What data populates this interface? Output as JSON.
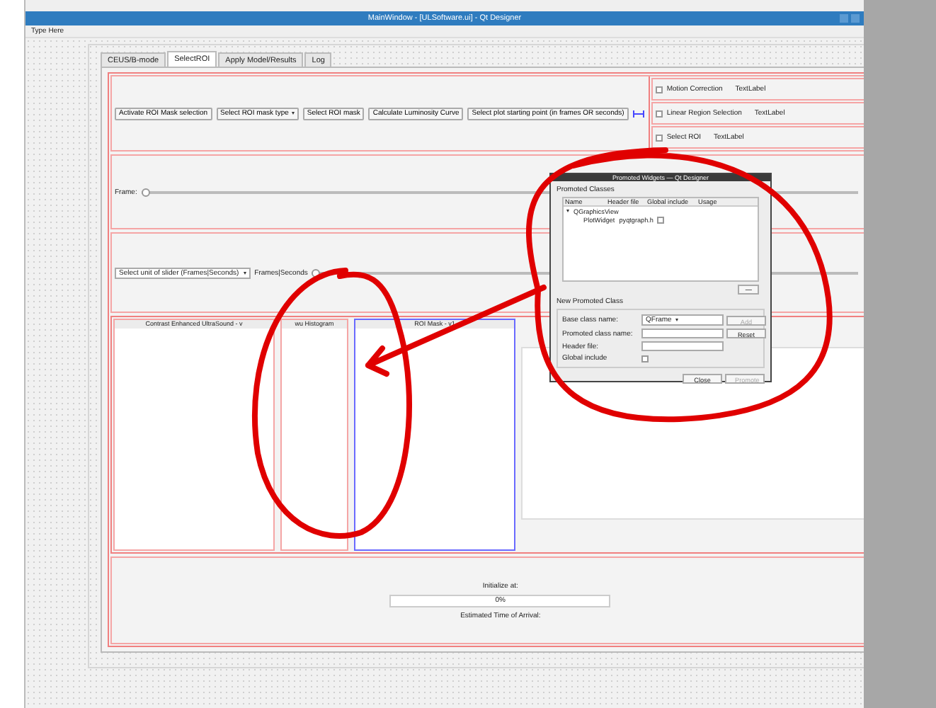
{
  "window": {
    "title": "MainWindow - [ULSoftware.ui] - Qt Designer"
  },
  "menu": [
    "Type Here"
  ],
  "tabs": [
    {
      "label": "CEUS/B-mode",
      "selected": false
    },
    {
      "label": "SelectROI",
      "selected": true
    },
    {
      "label": "Apply Model/Results",
      "selected": false
    },
    {
      "label": "Log",
      "selected": false
    }
  ],
  "toolbar": [
    {
      "kind": "button",
      "label": "Activate ROI Mask selection"
    },
    {
      "kind": "combo",
      "label": "Select ROI mask type"
    },
    {
      "kind": "button",
      "label": "Select ROI mask"
    },
    {
      "kind": "button",
      "label": "Calculate Luminosity Curve"
    },
    {
      "kind": "button",
      "label": "Select plot starting point (in frames OR seconds)"
    }
  ],
  "options": [
    {
      "label": "Motion Correction",
      "checked": false,
      "value": "TextLabel"
    },
    {
      "label": "Linear Region Selection",
      "checked": false,
      "value": "TextLabel"
    },
    {
      "label": "Select ROI",
      "checked": false,
      "value": "TextLabel"
    }
  ],
  "frame_slider": {
    "label": "Frame:",
    "level": 0
  },
  "unit_select": {
    "value": "Select unit of slider (Frames|Seconds)"
  },
  "unit_slider": {
    "label": "Frames|Seconds",
    "level": 0
  },
  "panels": [
    {
      "title": "Contrast Enhanced UltraSound - v",
      "selected": false
    },
    {
      "title": "wu Histogram",
      "selected": false
    },
    {
      "title": "ROI Mask - v1",
      "selected": true
    }
  ],
  "progress": {
    "label": "Initialize at:",
    "level": 0,
    "text": "0%",
    "eta": "Estimated Time of Arrival:"
  },
  "dialog": {
    "title": "Promoted Widgets — Qt Designer",
    "group": "Promoted Classes",
    "columns": [
      "Name",
      "Header file",
      "Global include",
      "Usage"
    ],
    "tree": [
      {
        "name": "QGraphicsView",
        "expanded": true,
        "children": [
          {
            "name": "PlotWidget",
            "header": "pyqtgraph.h",
            "global": false
          }
        ]
      }
    ],
    "remove_button": "—",
    "new_group": "New Promoted Class",
    "base_label": "Base class name:",
    "base_value": "QFrame",
    "add_button": {
      "label": "Add",
      "disabled": true
    },
    "class_label": "Promoted class name:",
    "reset_button": {
      "label": "Reset",
      "disabled": false
    },
    "header_label": "Header file:",
    "global_label": "Global include",
    "global_checked": false,
    "close_button": {
      "label": "Close",
      "disabled": false
    },
    "promote_button": {
      "label": "Promote",
      "disabled": true
    }
  }
}
